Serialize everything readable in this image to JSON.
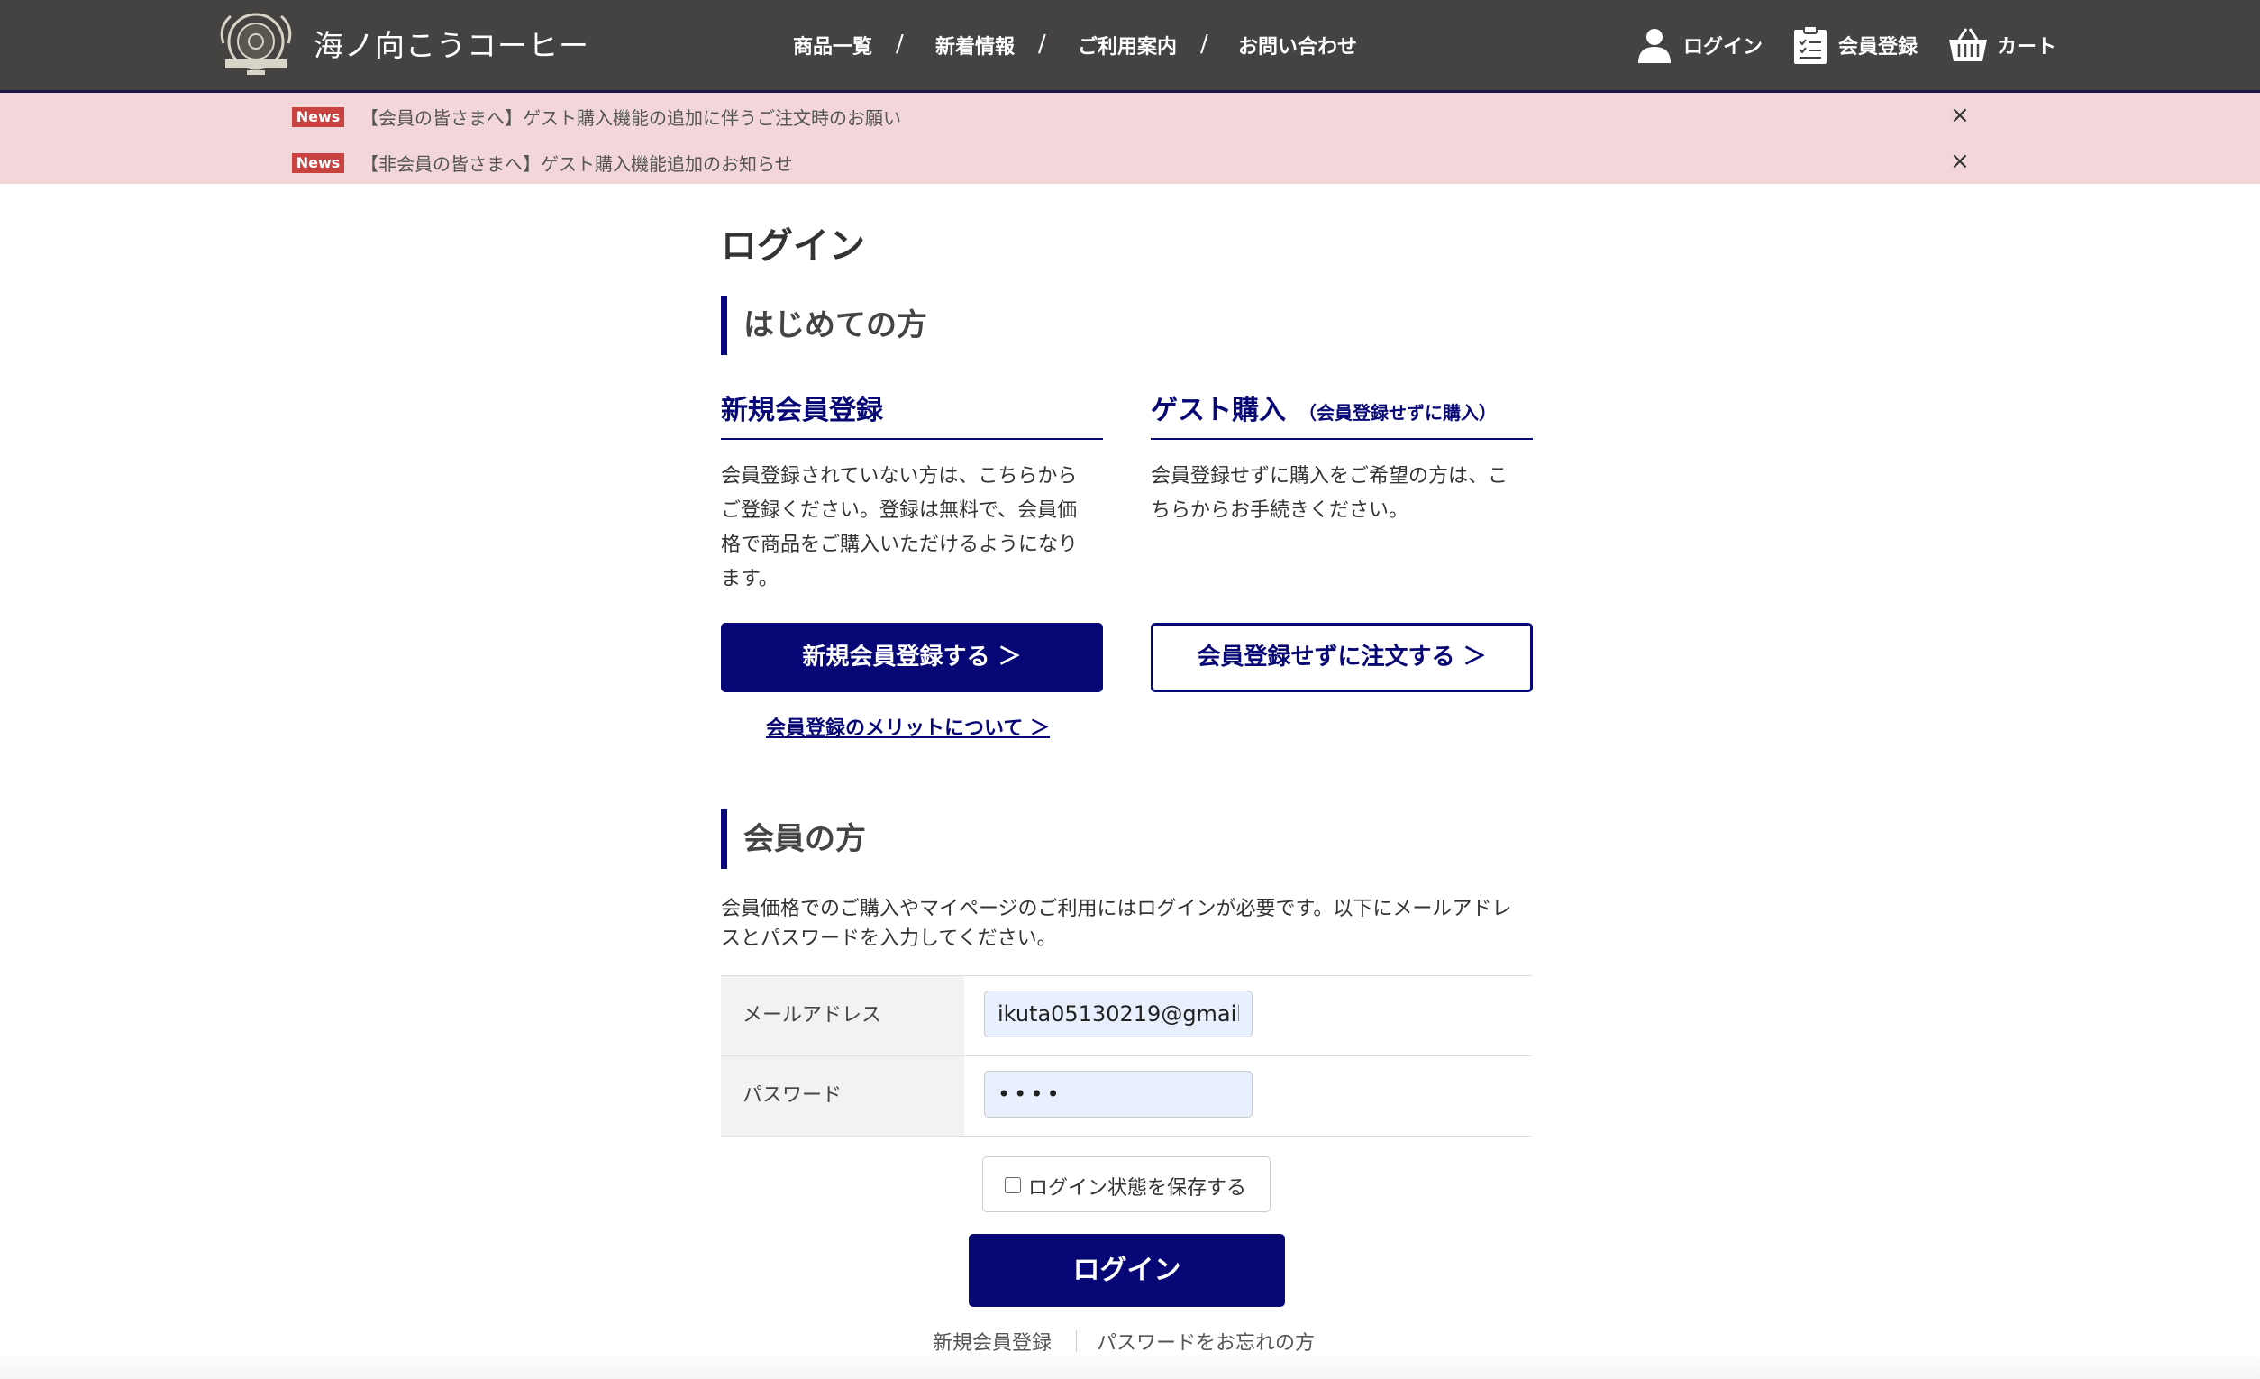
{
  "header": {
    "logo_text": "海ノ向こうコーヒー",
    "nav": [
      "商品一覧",
      "新着情報",
      "ご利用案内",
      "お問い合わせ"
    ],
    "nav_separator": "/",
    "login_label": "ログイン",
    "register_label": "会員登録",
    "cart_label": "カート"
  },
  "news": [
    {
      "badge": "News",
      "text": "【会員の皆さまへ】ゲスト購入機能の追加に伴うご注文時のお願い",
      "close": "×"
    },
    {
      "badge": "News",
      "text": "【非会員の皆さまへ】ゲスト購入機能追加のお知らせ",
      "close": "×"
    }
  ],
  "page_title": "ログイン",
  "first_time": {
    "heading": "はじめての方",
    "register": {
      "title": "新規会員登録",
      "lines": [
        "会員登録されていない方は、こちらから",
        "ご登録ください。登録は無料で、会員価",
        "格で商品をご購入いただけるようになり",
        "ます。"
      ],
      "button": "新規会員登録する ＞",
      "merit_link": "会員登録のメリットについて ＞"
    },
    "guest": {
      "title": "ゲスト購入",
      "title_note": "（会員登録せずに購入）",
      "lines": [
        "会員登録せずに購入をご希望の方は、こ",
        "ちらからお手続きください。"
      ],
      "button": "会員登録せずに注文する ＞"
    }
  },
  "member": {
    "heading": "会員の方",
    "lines": [
      "会員価格でのご購入やマイページのご利用にはログインが必要です。以下にメールアドレ",
      "スとパスワードを入力してください。"
    ],
    "email_label": "メールアドレス",
    "email_value": "ikuta05130219@gmail",
    "password_label": "パスワード",
    "password_value": "••••",
    "remember_label": "ログイン状態を保存する",
    "login_button": "ログイン",
    "footer_register": "新規会員登録",
    "footer_forgot": "パスワードをお忘れの方"
  }
}
